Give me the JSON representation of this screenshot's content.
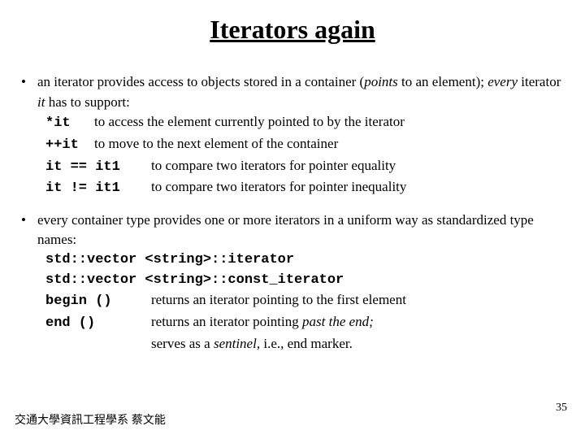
{
  "title": "Iterators again",
  "bullet1": {
    "intro_a": "an iterator provides access to objects stored in a container (",
    "intro_b": "points",
    "intro_c": " to an element); ",
    "intro_d": "every",
    "intro_e": " iterator ",
    "intro_f": "it",
    "intro_g": " has to support:",
    "r1_code": "*it",
    "r1_txt": "to access the element currently pointed to by the iterator",
    "r2_code": "++it",
    "r2_txt": "to move to the next element of the container",
    "r3_code": "it == it1",
    "r3_txt": "to compare two iterators for pointer equality",
    "r4_code": "it != it1",
    "r4_txt": "to compare two iterators for pointer inequality"
  },
  "bullet2": {
    "intro": "every container type provides one or more iterators in a uniform way as standardized type names:",
    "l1": "std::vector <string>::iterator",
    "l2": "std::vector <string>::const_iterator",
    "r1_code": "begin ()",
    "r1_txt": "returns an iterator pointing to the first element",
    "r2_code": "end ()",
    "r2_txt_a": "returns an iterator pointing ",
    "r2_txt_b": "past the end;",
    "r3_txt_a": "serves as a ",
    "r3_txt_b": "sentinel,",
    "r3_txt_c": " i.e., end marker."
  },
  "page_number": "35",
  "footer": "交通大學資訊工程學系 蔡文能"
}
